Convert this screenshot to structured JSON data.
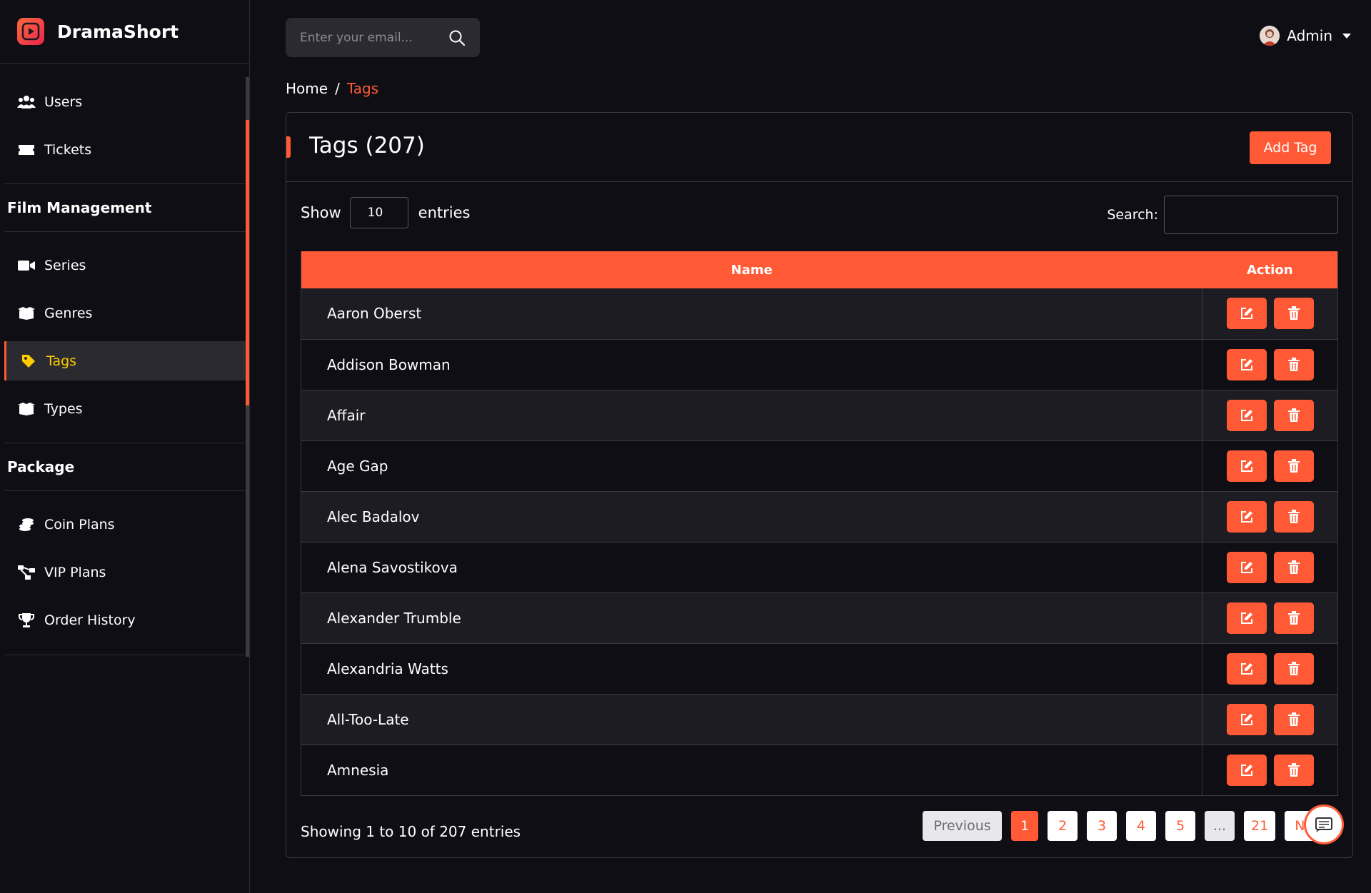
{
  "brand": {
    "name": "DramaShort"
  },
  "sidebar": {
    "items_top": [
      {
        "label": "Users",
        "icon": "users-icon"
      },
      {
        "label": "Tickets",
        "icon": "ticket-icon"
      }
    ],
    "section_film": "Film Management",
    "items_film": [
      {
        "label": "Series",
        "icon": "video-icon"
      },
      {
        "label": "Genres",
        "icon": "box-icon"
      },
      {
        "label": "Tags",
        "icon": "tag-icon",
        "active": true
      },
      {
        "label": "Types",
        "icon": "box-icon"
      }
    ],
    "section_package": "Package",
    "items_package": [
      {
        "label": "Coin Plans",
        "icon": "coins-icon"
      },
      {
        "label": "VIP Plans",
        "icon": "network-icon"
      },
      {
        "label": "Order History",
        "icon": "trophy-icon"
      }
    ]
  },
  "topbar": {
    "search_placeholder": "Enter your email...",
    "user_name": "Admin"
  },
  "breadcrumb": {
    "home": "Home",
    "separator": "/",
    "current": "Tags"
  },
  "card": {
    "title": "Tags (207)",
    "add_button": "Add Tag",
    "show_label": "Show",
    "entries_value": "10",
    "entries_label": "entries",
    "search_label": "Search:",
    "columns": [
      "Name",
      "Action"
    ],
    "rows": [
      "Aaron Oberst",
      "Addison Bowman",
      "Affair",
      "Age Gap",
      "Alec Badalov",
      "Alena Savostikova",
      "Alexander Trumble",
      "Alexandria Watts",
      "All-Too-Late",
      "Amnesia"
    ],
    "showing": "Showing 1 to 10 of 207 entries",
    "pagination": {
      "previous": "Previous",
      "pages": [
        "1",
        "2",
        "3",
        "4",
        "5",
        "...",
        "21"
      ],
      "active": "1",
      "next": "N"
    }
  },
  "colors": {
    "accent": "#ff5a35",
    "active_text": "#ffcc00",
    "background": "#0f0e14"
  }
}
